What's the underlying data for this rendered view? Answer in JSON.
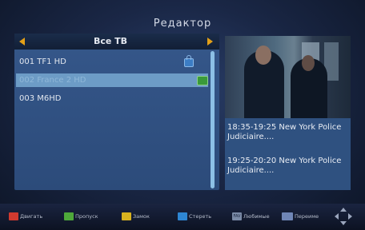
{
  "title": "Редактор",
  "list": {
    "group_label": "Все ТВ",
    "channels": [
      {
        "text": "001 TF1 HD",
        "locked": true,
        "favorite": false
      },
      {
        "text": "002 France 2 HD",
        "locked": false,
        "favorite": true,
        "selected": true
      },
      {
        "text": "003 M6HD",
        "locked": false,
        "favorite": false
      }
    ]
  },
  "epg": {
    "now": "18:35-19:25  New York Police Judiciaire....",
    "next": "19:25-20:20  New York Police Judiciaire...."
  },
  "footer": {
    "red": "Двигать",
    "green": "Пропуск",
    "yellow": "Замок",
    "blue": "Стереть",
    "fav_key": "FAV",
    "fav": "Любимые",
    "rename": "Переиме"
  },
  "colors": {
    "red_key": "#d13a2f",
    "green_key": "#4ea93a",
    "yellow_key": "#d8b21f",
    "blue_key": "#2e86d3",
    "selection": "#6d9cc6",
    "header_arrow": "#e3a018"
  },
  "icons": [
    "lock-icon",
    "favorite-icon",
    "arrow-left-icon",
    "arrow-right-icon",
    "dpad-icon"
  ]
}
